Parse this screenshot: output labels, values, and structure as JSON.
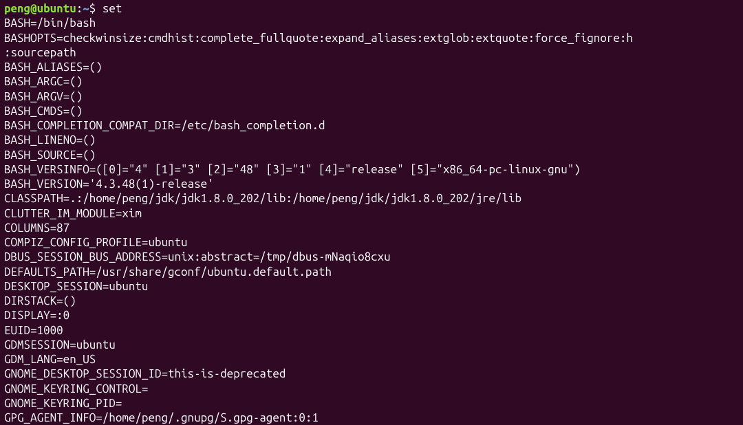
{
  "prompt": {
    "user": "peng@ubuntu",
    "colon": ":",
    "path": "~",
    "dollar": "$",
    "command": "set"
  },
  "output": [
    "BASH=/bin/bash",
    "BASHOPTS=checkwinsize:cmdhist:complete_fullquote:expand_aliases:extglob:extquote:force_fignore:h",
    ":sourcepath",
    "BASH_ALIASES=()",
    "BASH_ARGC=()",
    "BASH_ARGV=()",
    "BASH_CMDS=()",
    "BASH_COMPLETION_COMPAT_DIR=/etc/bash_completion.d",
    "BASH_LINENO=()",
    "BASH_SOURCE=()",
    "BASH_VERSINFO=([0]=\"4\" [1]=\"3\" [2]=\"48\" [3]=\"1\" [4]=\"release\" [5]=\"x86_64-pc-linux-gnu\")",
    "BASH_VERSION='4.3.48(1)-release'",
    "CLASSPATH=.:/home/peng/jdk/jdk1.8.0_202/lib:/home/peng/jdk/jdk1.8.0_202/jre/lib",
    "CLUTTER_IM_MODULE=xim",
    "COLUMNS=87",
    "COMPIZ_CONFIG_PROFILE=ubuntu",
    "DBUS_SESSION_BUS_ADDRESS=unix:abstract=/tmp/dbus-mNaqio8cxu",
    "DEFAULTS_PATH=/usr/share/gconf/ubuntu.default.path",
    "DESKTOP_SESSION=ubuntu",
    "DIRSTACK=()",
    "DISPLAY=:0",
    "EUID=1000",
    "GDMSESSION=ubuntu",
    "GDM_LANG=en_US",
    "GNOME_DESKTOP_SESSION_ID=this-is-deprecated",
    "GNOME_KEYRING_CONTROL=",
    "GNOME_KEYRING_PID=",
    "GPG_AGENT_INFO=/home/peng/.gnupg/S.gpg-agent:0:1"
  ]
}
